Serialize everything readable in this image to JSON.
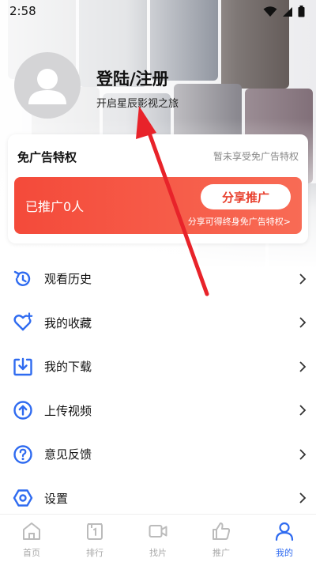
{
  "status_bar": {
    "time": "2:58"
  },
  "profile": {
    "title": "登陆/注册",
    "subtitle": "开启星辰影视之旅"
  },
  "ad_card": {
    "title": "免广告特权",
    "status": "暂未享受免广告特权",
    "promo_count": "已推广0人",
    "share_button": "分享推广",
    "share_hint": "分享可得终身免广告特权>"
  },
  "menu": [
    {
      "label": "观看历史",
      "icon": "history-icon"
    },
    {
      "label": "我的收藏",
      "icon": "heart-plus-icon"
    },
    {
      "label": "我的下载",
      "icon": "download-icon"
    },
    {
      "label": "上传视频",
      "icon": "upload-icon"
    },
    {
      "label": "意见反馈",
      "icon": "question-icon"
    },
    {
      "label": "设置",
      "icon": "settings-icon"
    }
  ],
  "bottom_nav": [
    {
      "label": "首页",
      "icon": "home-icon"
    },
    {
      "label": "排行",
      "icon": "ranking-icon"
    },
    {
      "label": "找片",
      "icon": "video-camera-icon"
    },
    {
      "label": "推广",
      "icon": "thumbs-up-icon"
    },
    {
      "label": "我的",
      "icon": "user-icon",
      "active": true
    }
  ],
  "colors": {
    "accent": "#2f6bf0",
    "ad_red": "#f44a3a",
    "annotation_arrow": "#e8232a"
  }
}
